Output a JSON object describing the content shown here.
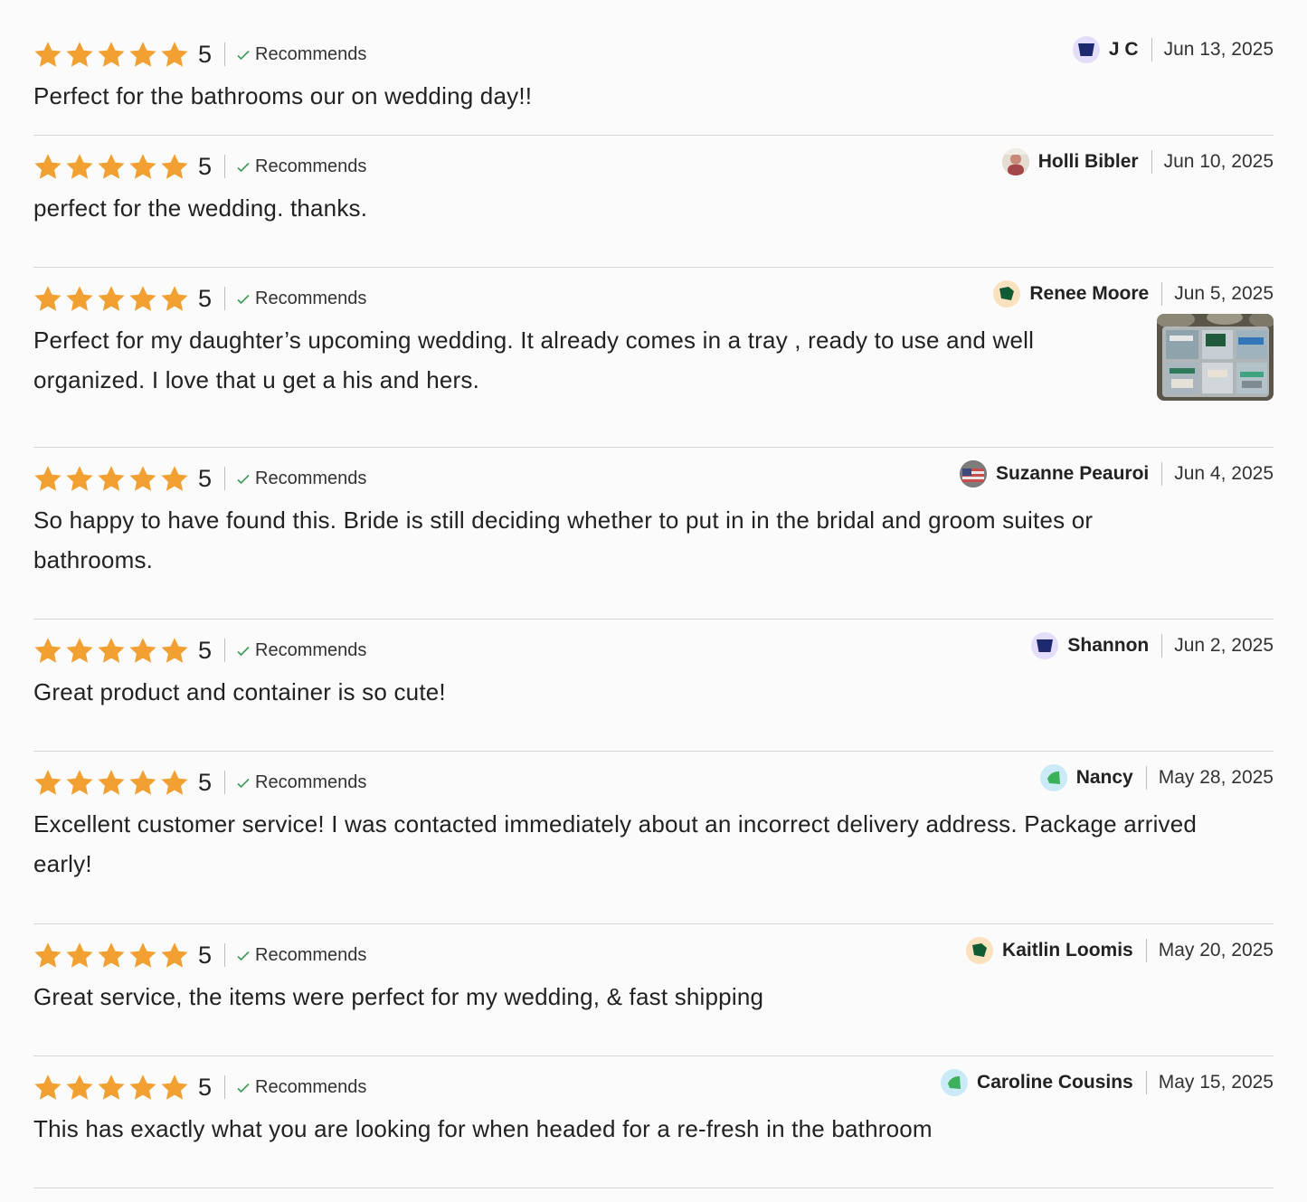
{
  "colors": {
    "star": "#f1a031",
    "check": "#3d9a58",
    "divider": "#d6d6d6",
    "text": "#222222"
  },
  "reviews": [
    {
      "rating": "5",
      "recommend_label": "Recommends",
      "author": "J C",
      "date": "Jun 13, 2025",
      "text": "Perfect for the bathrooms our on wedding day!!",
      "avatar_icon": "navy-shield-avatar"
    },
    {
      "rating": "5",
      "recommend_label": "Recommends",
      "author": "Holli Bibler",
      "date": "Jun 10, 2025",
      "text": "perfect for the wedding. thanks.",
      "avatar_icon": "photo-avatar"
    },
    {
      "rating": "5",
      "recommend_label": "Recommends",
      "author": "Renee Moore",
      "date": "Jun 5, 2025",
      "text": "Perfect for my daughter’s upcoming wedding. It already comes in a tray , ready to use and well organized. I love that u get a his and hers.",
      "avatar_icon": "green-hexagon-avatar",
      "has_photo": true
    },
    {
      "rating": "5",
      "recommend_label": "Recommends",
      "author": "Suzanne Peauroi",
      "date": "Jun 4, 2025",
      "text": "So happy to have found this. Bride is still deciding whether to put in in the bridal and groom suites or bathrooms.",
      "avatar_icon": "flag-photo-avatar"
    },
    {
      "rating": "5",
      "recommend_label": "Recommends",
      "author": "Shannon",
      "date": "Jun 2, 2025",
      "text": "Great product and container is so cute!",
      "avatar_icon": "navy-shield-avatar"
    },
    {
      "rating": "5",
      "recommend_label": "Recommends",
      "author": "Nancy",
      "date": "May 28, 2025",
      "text": "Excellent customer service! I was contacted immediately about an incorrect delivery address. Package arrived early!",
      "avatar_icon": "green-leaf-avatar"
    },
    {
      "rating": "5",
      "recommend_label": "Recommends",
      "author": "Kaitlin Loomis",
      "date": "May 20, 2025",
      "text": "Great service, the items were perfect for my wedding, & fast shipping",
      "avatar_icon": "green-hexagon-avatar"
    },
    {
      "rating": "5",
      "recommend_label": "Recommends",
      "author": "Caroline Cousins",
      "date": "May 15, 2025",
      "text": "This has exactly what you are looking for when headed for a re-fresh in the bathroom",
      "avatar_icon": "green-leaf-avatar"
    }
  ]
}
